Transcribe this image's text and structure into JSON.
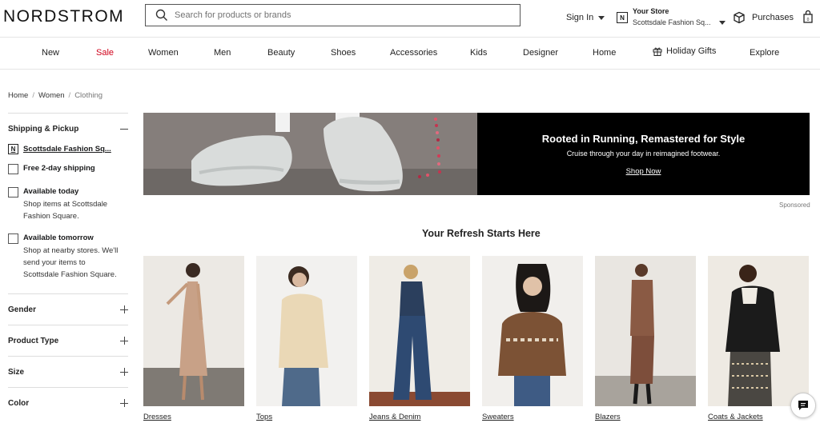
{
  "header": {
    "logo": "NORDSTROM",
    "search_placeholder": "Search for products or brands",
    "sign_in": "Sign In",
    "store_label": "Your Store",
    "store_name": "Scottsdale Fashion Sq...",
    "store_badge": "N",
    "purchases": "Purchases"
  },
  "nav": {
    "items": [
      {
        "label": "New"
      },
      {
        "label": "Sale"
      },
      {
        "label": "Women"
      },
      {
        "label": "Men"
      },
      {
        "label": "Beauty"
      },
      {
        "label": "Shoes"
      },
      {
        "label": "Accessories"
      },
      {
        "label": "Kids"
      },
      {
        "label": "Designer"
      },
      {
        "label": "Home"
      },
      {
        "label": "Holiday Gifts"
      },
      {
        "label": "Explore"
      }
    ],
    "sale_color": "#d0021b"
  },
  "breadcrumb": [
    "Home",
    "Women",
    "Clothing"
  ],
  "sidebar": {
    "shipping_title": "Shipping & Pickup",
    "store_link": "Scottsdale Fashion Sq...",
    "options": [
      {
        "title": "Free 2-day shipping",
        "sub": ""
      },
      {
        "title": "Available today",
        "sub": "Shop items at Scottsdale Fashion Square."
      },
      {
        "title": "Available tomorrow",
        "sub": "Shop at nearby stores. We'll send your items to Scottsdale Fashion Square."
      }
    ],
    "filters": [
      "Gender",
      "Product Type",
      "Size",
      "Color"
    ]
  },
  "banner": {
    "headline": "Rooted in Running, Remastered for Style",
    "sub": "Cruise through your day in reimagined footwear.",
    "cta": "Shop Now",
    "sponsored": "Sponsored"
  },
  "section_title": "Your Refresh Starts Here",
  "categories": [
    {
      "label": "Dresses"
    },
    {
      "label": "Tops"
    },
    {
      "label": "Jeans & Denim"
    },
    {
      "label": "Sweaters"
    },
    {
      "label": "Blazers"
    },
    {
      "label": "Coats & Jackets"
    }
  ]
}
